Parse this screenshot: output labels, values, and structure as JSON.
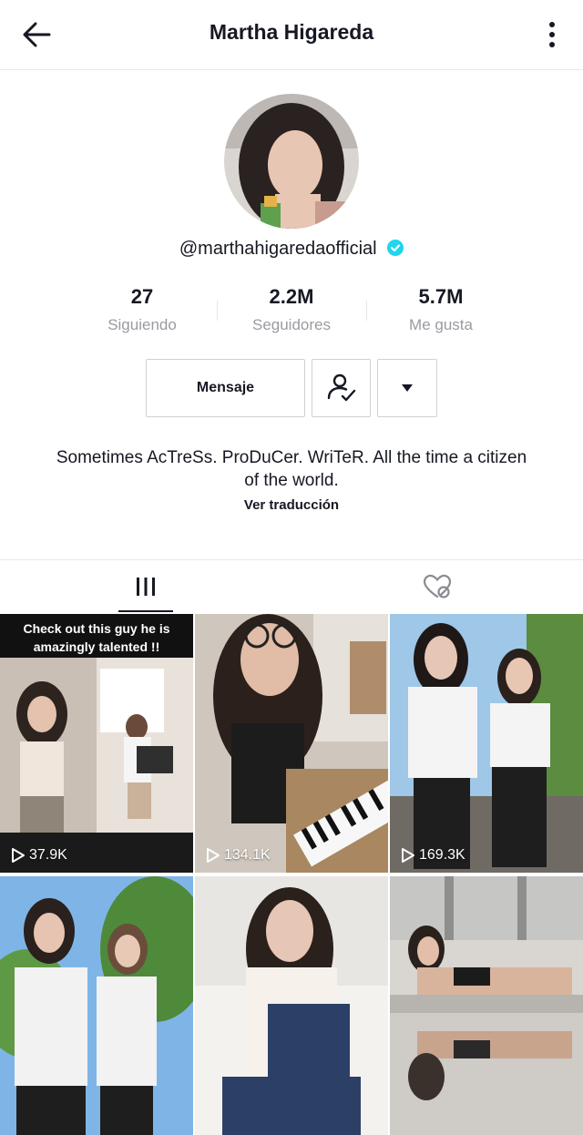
{
  "header": {
    "title": "Martha Higareda",
    "back_icon": "arrow-left-icon",
    "more_icon": "vertical-dots-icon"
  },
  "profile": {
    "handle": "@marthahigaredaofficial",
    "verified_color": "#20D5EC",
    "stats": [
      {
        "value": "27",
        "label": "Siguiendo"
      },
      {
        "value": "2.2M",
        "label": "Seguidores"
      },
      {
        "value": "5.7M",
        "label": "Me gusta"
      }
    ],
    "bio": "Sometimes AcTreSs. ProDuCer. WriTeR. All the time a citizen of the world.",
    "translate_label": "Ver traducción"
  },
  "actions": {
    "message_label": "Mensaje",
    "follow_icon": "user-check-icon",
    "more_icon": "caret-down-icon"
  },
  "tabs": {
    "videos_icon": "grid-icon",
    "liked_icon": "heart-hidden-icon"
  },
  "videos": [
    {
      "views": "37.9K",
      "caption": "Check out this guy he is amazingly talented !!"
    },
    {
      "views": "134.1K"
    },
    {
      "views": "169.3K"
    },
    {
      "views": ""
    },
    {
      "views": ""
    },
    {
      "views": ""
    }
  ]
}
